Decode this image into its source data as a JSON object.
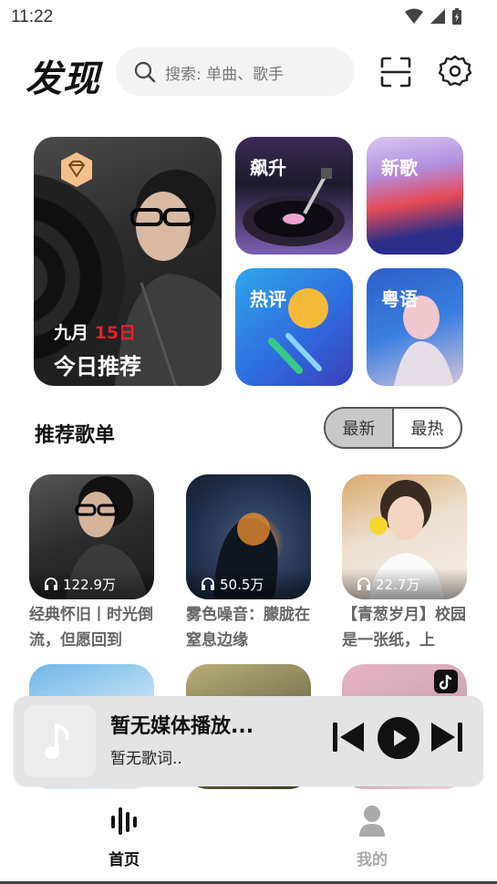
{
  "status": {
    "time": "11:22"
  },
  "header": {
    "logo": "发现",
    "search_placeholder": "搜索: 单曲、歌手"
  },
  "feature": {
    "date_month": "九月",
    "date_day": "15日",
    "title": "今日推荐"
  },
  "tiles": [
    {
      "label": "飙升"
    },
    {
      "label": "新歌"
    },
    {
      "label": "热评"
    },
    {
      "label": "粤语"
    }
  ],
  "playlists_section": {
    "title": "推荐歌单",
    "toggle": {
      "newest": "最新",
      "hottest": "最热",
      "active": "newest"
    }
  },
  "playlists": [
    {
      "plays": "122.9万",
      "title": "经典怀旧丨时光倒流，但愿回到"
    },
    {
      "plays": "50.5万",
      "title": "雾色噪音：朦胧在窒息边缘"
    },
    {
      "plays": "22.7万",
      "title": "【青葱岁月】校园是一张纸，上"
    },
    {
      "plays": "",
      "title": ""
    },
    {
      "plays": "",
      "title": ""
    },
    {
      "plays": "",
      "title": ""
    }
  ],
  "player": {
    "title": "暂无媒体播放...",
    "lyrics": "暂无歌词.."
  },
  "tabbar": {
    "home": "首页",
    "mine": "我的",
    "active": "home"
  },
  "icons": {
    "search": "search-icon",
    "scan": "scan-icon",
    "settings": "gear-icon",
    "headphones": "headphones-icon",
    "music_note": "music-note-icon",
    "prev": "skip-previous-icon",
    "play": "play-icon",
    "next": "skip-next-icon",
    "home": "sound-bars-icon",
    "mine": "person-icon"
  }
}
